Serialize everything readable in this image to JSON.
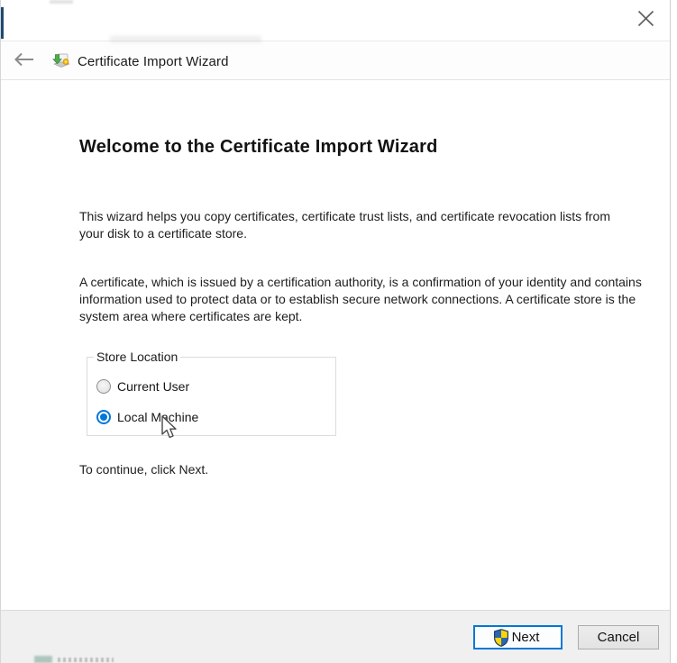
{
  "window": {
    "close_icon": "close-x"
  },
  "header": {
    "back_icon": "left-arrow",
    "app_icon": "certificate-import-icon",
    "title": "Certificate Import Wizard"
  },
  "main": {
    "heading": "Welcome to the Certificate Import Wizard",
    "paragraph1": "This wizard helps you copy certificates, certificate trust lists, and certificate revocation lists from your disk to a certificate store.",
    "paragraph2": "A certificate, which is issued by a certification authority, is a confirmation of your identity and contains information used to protect data or to establish secure network connections. A certificate store is the system area where certificates are kept.",
    "store_location": {
      "legend": "Store Location",
      "options": [
        {
          "label": "Current User",
          "selected": false
        },
        {
          "label": "Local Machine",
          "selected": true
        }
      ]
    },
    "continue_hint": "To continue, click Next."
  },
  "footer": {
    "next_label": "Next",
    "cancel_label": "Cancel"
  },
  "colors": {
    "accent": "#0078d7",
    "navy_strip": "#1e4a73",
    "footer_bg": "#f0f0f0",
    "shield_blue": "#2e66ad",
    "shield_yellow": "#fbd506"
  }
}
